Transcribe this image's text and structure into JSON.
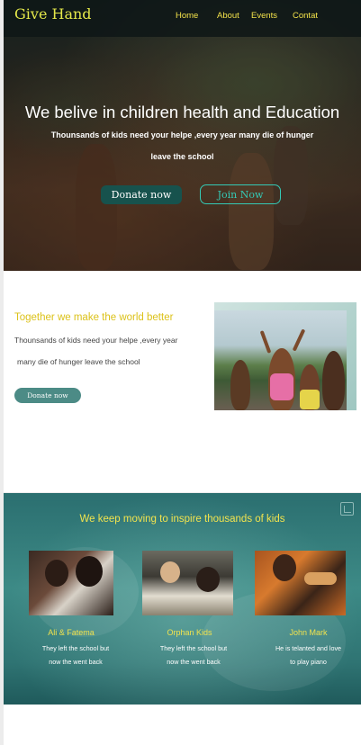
{
  "brand": "Give Hand",
  "nav": [
    "Home",
    "About",
    "Events",
    "Contat"
  ],
  "hero": {
    "title": "We belive in children health and Education",
    "subtitle_line1": "Thounsands of kids need your helpe ,every year many  die of hunger",
    "subtitle_line2": "leave the school",
    "donate_label": "Donate now",
    "join_label": "Join Now"
  },
  "about": {
    "title": "Together we make the world better",
    "text_line1": "Thounsands of kids need your helpe ,every year",
    "text_line2": "many  die of hunger  leave the school",
    "donate_label": "Donate now"
  },
  "inspire": {
    "title": "We keep moving to inspire thousands of kids",
    "cards": [
      {
        "name": "Ali & Fatema",
        "desc_line1": "They left the school but",
        "desc_line2": "now the went back"
      },
      {
        "name": "Orphan Kids",
        "desc_line1": "They left the school but",
        "desc_line2": "now the went back"
      },
      {
        "name": "John Mark",
        "desc_line1": "He is telanted and love",
        "desc_line2": "to play piano"
      }
    ]
  },
  "icons": {
    "corner": "expand-icon"
  },
  "colors": {
    "accent_yellow": "#f1e34e",
    "teal_button": "#17524d",
    "teal_outline": "#34c9b5",
    "section_teal": "#3d8a86"
  }
}
